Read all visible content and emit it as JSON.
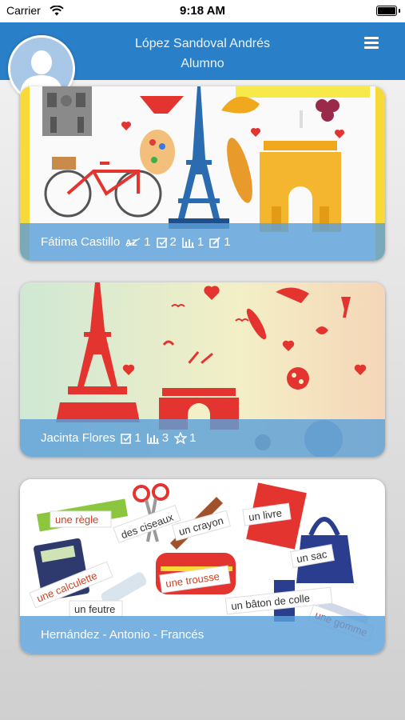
{
  "status_bar": {
    "carrier": "Carrier",
    "time": "9:18 AM"
  },
  "header": {
    "user_name": "López Sandoval Andrés",
    "role": "Alumno"
  },
  "courses": [
    {
      "title": "Fátima Castillo",
      "stats": [
        {
          "icon": "az-icon",
          "value": "1"
        },
        {
          "icon": "check-square-icon",
          "value": "2"
        },
        {
          "icon": "bar-chart-icon",
          "value": "1"
        },
        {
          "icon": "edit-icon",
          "value": "1"
        }
      ]
    },
    {
      "title": "Jacinta Flores",
      "stats": [
        {
          "icon": "check-square-icon",
          "value": "1"
        },
        {
          "icon": "bar-chart-icon",
          "value": "3"
        },
        {
          "icon": "star-icon",
          "value": "1"
        }
      ]
    },
    {
      "title": "Hernández - Antonio - Francés",
      "stats": [],
      "image_labels": [
        "une règle",
        "des ciseaux",
        "un crayon",
        "un livre",
        "un sac",
        "une calculette",
        "une trousse",
        "un feutre",
        "un bâton de colle",
        "une gomme"
      ]
    }
  ],
  "colors": {
    "header": "#2a80c8",
    "card_bar": "#5ca0d9",
    "eiffel_blue": "#2b6cb0",
    "arc_gold": "#f0a81c",
    "eiffel_red": "#e3342f"
  }
}
